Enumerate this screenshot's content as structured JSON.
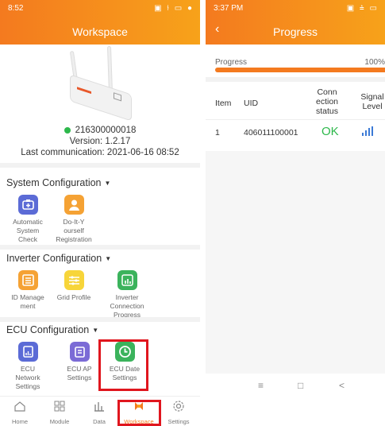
{
  "left": {
    "status_time": "8:52",
    "status_icons": "▣ ⫮ ▭ ●",
    "title": "Workspace",
    "device": {
      "serial": "216300000018",
      "version": "Version: 1.2.17",
      "last_comm": "Last communication: 2021-06-16 08:52",
      "status_color": "#2db84b"
    },
    "sections": [
      {
        "title": "System Configuration",
        "items": [
          {
            "label": "Automatic System Check",
            "lines": [
              "Automatic",
              "System",
              "Check"
            ],
            "icon": "system-check-icon",
            "color": "#5b6bd6"
          },
          {
            "label": "Do-It-Yourself Registration",
            "lines": [
              "Do-It-Y",
              "ourself",
              "Registration"
            ],
            "icon": "person-icon",
            "color": "#f5a234"
          }
        ]
      },
      {
        "title": "Inverter Configuration",
        "items": [
          {
            "label": "ID Management",
            "lines": [
              "ID Manage",
              "ment"
            ],
            "icon": "id-manage-icon",
            "color": "#f5a234"
          },
          {
            "label": "Grid Profile",
            "lines": [
              "Grid Profile"
            ],
            "icon": "grid-profile-icon",
            "color": "#f7d53a"
          },
          {
            "label": "Inverter Connection Progress",
            "lines": [
              "Inverter",
              "Connection",
              "Progress"
            ],
            "icon": "inverter-progress-icon",
            "color": "#3bb35c"
          }
        ]
      },
      {
        "title": "ECU Configuration",
        "items": [
          {
            "label": "ECU Network Settings",
            "lines": [
              "ECU",
              "Network",
              "Settings"
            ],
            "icon": "ecu-network-icon",
            "color": "#5b6bd6"
          },
          {
            "label": "ECU AP Settings",
            "lines": [
              "ECU AP",
              "Settings"
            ],
            "icon": "ecu-ap-icon",
            "color": "#7b6bd6"
          },
          {
            "label": "ECU Date Settings",
            "lines": [
              "ECU Date",
              "Settings"
            ],
            "icon": "clock-icon",
            "color": "#3bb35c"
          }
        ]
      }
    ],
    "tabs": [
      {
        "label": "Home",
        "icon": "home-icon"
      },
      {
        "label": "Module",
        "icon": "module-grid-icon"
      },
      {
        "label": "Data",
        "icon": "data-bars-icon"
      },
      {
        "label": "Workspace",
        "icon": "workspace-icon",
        "active": true
      },
      {
        "label": "Settings",
        "icon": "gear-icon"
      }
    ],
    "accent": "#f47a1f",
    "highlight": "#e0161e"
  },
  "right": {
    "status_time": "3:37 PM",
    "title": "Progress",
    "progress_label": "Progress",
    "progress_pct": "100%",
    "progress_value": 1.0,
    "headers": {
      "item": "Item",
      "uid": "UID",
      "conn": [
        "Conn",
        "ection",
        "status"
      ],
      "signal": [
        "Signal",
        "Level"
      ]
    },
    "rows": [
      {
        "item": "1",
        "uid": "406011100001",
        "status": "OK",
        "signal": "signal-bars-icon"
      }
    ],
    "nav": [
      "≡",
      "□",
      "<"
    ]
  }
}
